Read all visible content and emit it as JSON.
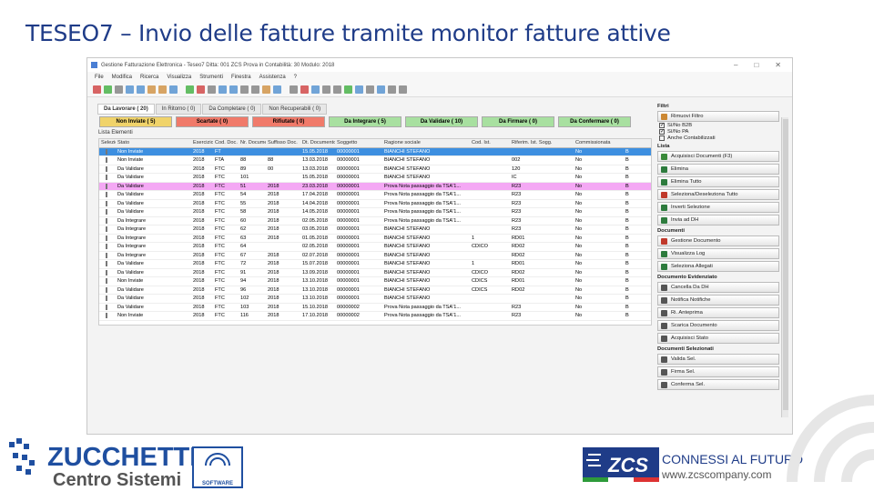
{
  "slide": {
    "title": "TESEO7 – Invio delle fatture tramite monitor fatture attive"
  },
  "app": {
    "title": "Gestione Fatturazione Elettronica - Teseo7 Ditta: 001 ZCS Prova in Contabilità: 30 Modulo: 2018",
    "menu": [
      "File",
      "Modifica",
      "Ricerca",
      "Visualizza",
      "Strumenti",
      "Finestra",
      "Assistenza",
      "?"
    ],
    "tabs": [
      "Da Lavorare ( 20)",
      "In Ritorno ( 0)",
      "Da Completare ( 0)",
      "Non Recuperabili ( 0)"
    ],
    "status_buttons": [
      {
        "label": "Non Inviate ( 5)",
        "color": "#f0d36a",
        "w": 80
      },
      {
        "label": "Scartate ( 0)",
        "color": "#f07a6a",
        "w": 80
      },
      {
        "label": "Rifiutate ( 0)",
        "color": "#f07a6a",
        "w": 80
      },
      {
        "label": "Da Integrare ( 5)",
        "color": "#a8e0a0",
        "w": 80
      },
      {
        "label": "Da Validare ( 10)",
        "color": "#a8e0a0",
        "w": 80
      },
      {
        "label": "Da Firmare ( 0)",
        "color": "#a8e0a0",
        "w": 80
      },
      {
        "label": "Da Confermare ( 0)",
        "color": "#a8e0a0",
        "w": 80
      }
    ],
    "subtitle": "Lista Elementi",
    "columns": [
      "Seleziona",
      "Stato",
      "Esercizio",
      "Cod. Doc.",
      "Nr. Documento",
      "Suffisso Doc.",
      "Dt. Documento",
      "Soggetto",
      "Ragione sociale",
      "Cod. Ist.",
      "Riferim. Ist. Sogg.",
      "Commissionata",
      ""
    ],
    "col_widths": [
      18,
      83,
      24,
      28,
      30,
      38,
      38,
      52,
      96,
      44,
      70,
      55,
      10
    ],
    "rows": [
      {
        "cls": "sel",
        "cells": [
          "",
          "Non Inviate",
          "2018",
          "FT",
          "",
          "",
          "15.05.2018",
          "00000001",
          "BIANCHI STEFANO",
          "",
          "",
          "No",
          "B"
        ]
      },
      {
        "cls": "",
        "cells": [
          "",
          "Non Inviate",
          "2018",
          "FTA",
          "88",
          "88",
          "13.03.2018",
          "00000001",
          "BIANCHI STEFANO",
          "",
          "002",
          "No",
          "B"
        ]
      },
      {
        "cls": "",
        "cells": [
          "",
          "Da Validare",
          "2018",
          "FTC",
          "89",
          "00",
          "13.03.2018",
          "00000001",
          "BIANCHI STEFANO",
          "",
          "120",
          "No",
          "B"
        ]
      },
      {
        "cls": "",
        "cells": [
          "",
          "Da Validare",
          "2018",
          "FTC",
          "101",
          "",
          "15.05.2018",
          "00000001",
          "BIANCHI STEFANO",
          "",
          "IC",
          "No",
          "B"
        ]
      },
      {
        "cls": "pink",
        "cells": [
          "",
          "Da Validare",
          "2018",
          "FTC",
          "51",
          "2018",
          "23.03.2018",
          "00000001",
          "Prova Nota passaggio da TSA'1...",
          "",
          "R23",
          "No",
          "B"
        ]
      },
      {
        "cls": "",
        "cells": [
          "",
          "Da Validare",
          "2018",
          "FTC",
          "54",
          "2018",
          "17.04.2018",
          "00000001",
          "Prova Nota passaggio da TSA'1...",
          "",
          "R23",
          "No",
          "B"
        ]
      },
      {
        "cls": "",
        "cells": [
          "",
          "Da Validare",
          "2018",
          "FTC",
          "55",
          "2018",
          "14.04.2018",
          "00000001",
          "Prova Nota passaggio da TSA'1...",
          "",
          "R23",
          "No",
          "B"
        ]
      },
      {
        "cls": "",
        "cells": [
          "",
          "Da Validare",
          "2018",
          "FTC",
          "58",
          "2018",
          "14.05.2018",
          "00000001",
          "Prova Nota passaggio da TSA'1...",
          "",
          "R23",
          "No",
          "B"
        ]
      },
      {
        "cls": "",
        "cells": [
          "",
          "Da Integrare",
          "2018",
          "FTC",
          "60",
          "2018",
          "02.05.2018",
          "00000001",
          "Prova Nota passaggio da TSA'1...",
          "",
          "R23",
          "No",
          "B"
        ]
      },
      {
        "cls": "",
        "cells": [
          "",
          "Da Integrare",
          "2018",
          "FTC",
          "62",
          "2018",
          "03.05.2018",
          "00000001",
          "BIANCHI STEFANO",
          "",
          "R23",
          "No",
          "B"
        ]
      },
      {
        "cls": "",
        "cells": [
          "",
          "Da Integrare",
          "2018",
          "FTC",
          "63",
          "2018",
          "01.05.2018",
          "00000001",
          "BIANCHI STEFANO",
          "1",
          "RD01",
          "No",
          "B"
        ]
      },
      {
        "cls": "",
        "cells": [
          "",
          "Da Integrare",
          "2018",
          "FTC",
          "64",
          "",
          "02.05.2018",
          "00000001",
          "BIANCHI STEFANO",
          "CDICO",
          "RD02",
          "No",
          "B"
        ]
      },
      {
        "cls": "",
        "cells": [
          "",
          "Da Integrare",
          "2018",
          "FTC",
          "67",
          "2018",
          "02.07.2018",
          "00000001",
          "BIANCHI STEFANO",
          "",
          "RD02",
          "No",
          "B"
        ]
      },
      {
        "cls": "",
        "cells": [
          "",
          "Da Validare",
          "2018",
          "FTC",
          "72",
          "2018",
          "15.07.2018",
          "00000001",
          "BIANCHI STEFANO",
          "1",
          "RD01",
          "No",
          "B"
        ]
      },
      {
        "cls": "",
        "cells": [
          "",
          "Da Validare",
          "2018",
          "FTC",
          "91",
          "2018",
          "13.09.2018",
          "00000001",
          "BIANCHI STEFANO",
          "CDICO",
          "RD02",
          "No",
          "B"
        ]
      },
      {
        "cls": "",
        "cells": [
          "",
          "Non Inviate",
          "2018",
          "FTC",
          "94",
          "2018",
          "13.10.2018",
          "00000001",
          "BIANCHI STEFANO",
          "CDICS",
          "RD01",
          "No",
          "B"
        ]
      },
      {
        "cls": "",
        "cells": [
          "",
          "Da Validare",
          "2018",
          "FTC",
          "96",
          "2018",
          "13.10.2018",
          "00000001",
          "BIANCHI STEFANO",
          "CDICS",
          "RD02",
          "No",
          "B"
        ]
      },
      {
        "cls": "",
        "cells": [
          "",
          "Da Validare",
          "2018",
          "FTC",
          "102",
          "2018",
          "13.10.2018",
          "00000001",
          "BIANCHI STEFANO",
          "",
          "",
          "No",
          "B"
        ]
      },
      {
        "cls": "",
        "cells": [
          "",
          "Da Validare",
          "2018",
          "FTC",
          "103",
          "2018",
          "15.10.2018",
          "00000002",
          "Prova Nota passaggio da TSA'1...",
          "",
          "R23",
          "No",
          "B"
        ]
      },
      {
        "cls": "",
        "cells": [
          "",
          "Non Inviate",
          "2018",
          "FTC",
          "116",
          "2018",
          "17.10.2018",
          "00000002",
          "Prova Nota passaggio da TSA'1...",
          "",
          "R23",
          "No",
          "B"
        ]
      }
    ],
    "panel": {
      "filters_title": "Filtri",
      "filter_btn": "Rimuovi Filtro",
      "checks": [
        {
          "label": "Sì/No B2B",
          "on": true
        },
        {
          "label": "Sì/No PA",
          "on": true
        },
        {
          "label": "Anche Contabilizzati",
          "on": false
        }
      ],
      "list_title": "Lista",
      "list_btns": [
        {
          "label": "Acquisisci Documenti (F3)",
          "c": "#3a8a3a"
        },
        {
          "label": "Elimina",
          "c": "#2d7b3d"
        },
        {
          "label": "Elimina Tutto",
          "c": "#2d7b3d"
        },
        {
          "label": "Seleziona/Deseleziona Tutto",
          "c": "#c0392b"
        },
        {
          "label": "Inverti Selezione",
          "c": "#2d7b3d"
        },
        {
          "label": "Invia ad DH",
          "c": "#2d7b3d"
        }
      ],
      "docs_title": "Documenti",
      "docs_btns": [
        {
          "label": "Gestione Documento",
          "c": "#c0392b"
        },
        {
          "label": "Visualizza Log",
          "c": "#2d7b3d"
        },
        {
          "label": "Seleziona Allegati",
          "c": "#2d7b3d"
        }
      ],
      "actions_title": "Documento Evidenziato",
      "action_btns": [
        {
          "label": "Cancella Da DH",
          "c": "#555"
        },
        {
          "label": "Notifica Notifiche",
          "c": "#555"
        },
        {
          "label": "Ri. Anteprima",
          "c": "#555"
        },
        {
          "label": "Scarica Documento",
          "c": "#555"
        },
        {
          "label": "Acquisisci Stato",
          "c": "#555"
        }
      ],
      "sel_title": "Documenti Selezionati",
      "sel_btns": [
        {
          "label": "Valida Sel.",
          "c": "#555"
        },
        {
          "label": "Firma Sel.",
          "c": "#555"
        },
        {
          "label": "Conferma Sel.",
          "c": "#555"
        }
      ]
    }
  },
  "footer": {
    "brand_top": "ZUCCHETTI",
    "brand_bottom": "Centro Sistemi",
    "software_label": "SOFTWARE",
    "zcs_label": "ZCS",
    "tagline": "CONNESSI AL FUTURO",
    "url": "www.zcscompany.com"
  }
}
